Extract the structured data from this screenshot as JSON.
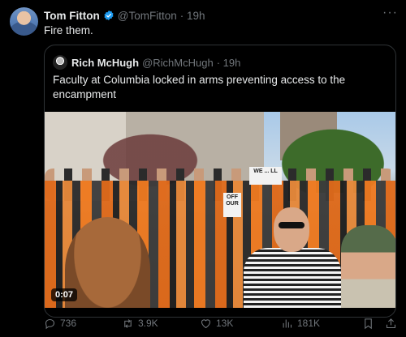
{
  "tweet": {
    "author_name": "Tom Fitton",
    "author_handle": "@TomFitton",
    "time": "· 19h",
    "text": "Fire them.",
    "more": "···"
  },
  "quote": {
    "author_name": "Rich McHugh",
    "author_handle": "@RichMcHugh",
    "time": "· 19h",
    "text": "Faculty at Columbia locked in arms preventing access to the encampment",
    "video_duration": "0:07",
    "sign_1": "WE ... LL",
    "sign_2": "OFF OUR"
  },
  "actions": {
    "replies": "736",
    "retweets": "3.9K",
    "likes": "13K",
    "views": "181K"
  },
  "colors": {
    "background": "#000000",
    "text": "#e7e9ea",
    "muted": "#71767b",
    "border": "#2f3336",
    "verified": "#1d9bf0"
  },
  "icons": [
    "verified-badge-icon",
    "more-options-icon",
    "reply-icon",
    "retweet-icon",
    "like-icon",
    "views-icon",
    "bookmark-icon",
    "share-icon"
  ]
}
